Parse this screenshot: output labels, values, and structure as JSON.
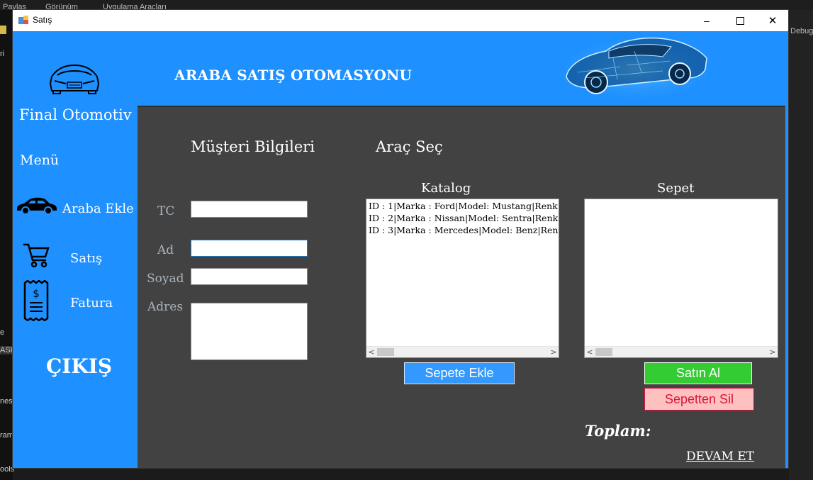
{
  "background": {
    "ribbon_tabs": [
      "Paylaş",
      "Görünüm",
      "Uygulama Araçları"
    ],
    "right_text": "Debug",
    "left_fragments": [
      "ri",
      "e",
      "ASKI",
      "nes",
      "ram",
      "ools"
    ]
  },
  "window": {
    "title": "Satış",
    "minimize": "–",
    "maximize": "☐",
    "close": "✕"
  },
  "header": {
    "title": "ARABA SATIŞ OTOMASYONU"
  },
  "sidebar": {
    "brand": "Final Otomotiv",
    "menu_label": "Menü",
    "items": [
      {
        "label": "Araba Ekle",
        "icon": "car-icon"
      },
      {
        "label": "Satış",
        "icon": "shopping-cart-icon"
      },
      {
        "label": "Fatura",
        "icon": "receipt-icon"
      }
    ],
    "exit_label": "ÇIKIŞ"
  },
  "customer": {
    "section_title": "Müşteri Bilgileri",
    "fields": [
      {
        "label": "TC",
        "value": ""
      },
      {
        "label": "Ad",
        "value": ""
      },
      {
        "label": "Soyad",
        "value": ""
      },
      {
        "label": "Adres",
        "value": ""
      }
    ]
  },
  "vehicle": {
    "section_title": "Araç Seç",
    "catalog_title": "Katalog",
    "catalog_items": [
      "ID :  1|Marka :  Ford|Model:  Mustang|Renk",
      "ID :  2|Marka :  Nissan|Model:  Sentra|Renk",
      "ID :  3|Marka :  Mercedes|Model:  Benz|Renk"
    ],
    "cart_title": "Sepet",
    "cart_items": []
  },
  "buttons": {
    "add_to_cart": "Sepete Ekle",
    "buy": "Satın Al",
    "remove_from_cart": "Sepetten Sil",
    "continue": "DEVAM ET"
  },
  "total_label": "Toplam:",
  "colors": {
    "brand_blue": "#1e90ff",
    "panel_gray": "#424242",
    "add_button": "#3399ff",
    "buy_button": "#33cc33",
    "remove_button_bg": "#ffc0c0",
    "remove_button_text": "#dc143c"
  }
}
